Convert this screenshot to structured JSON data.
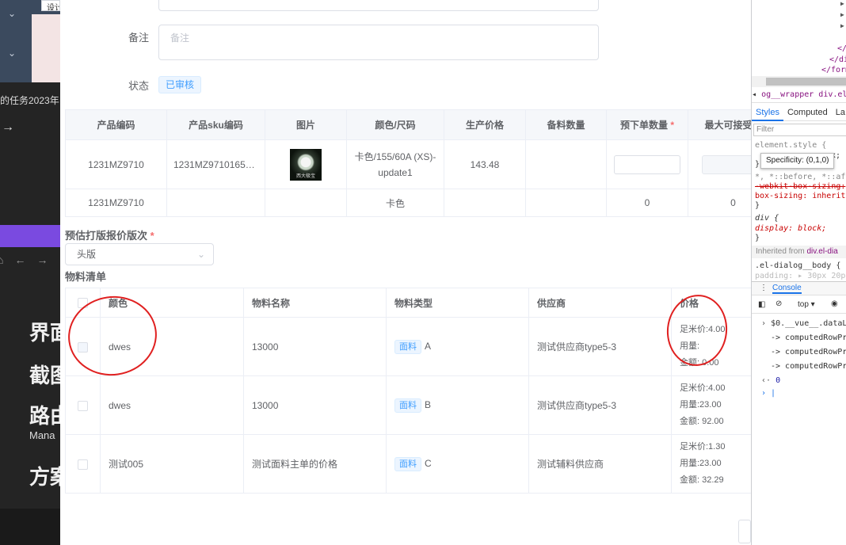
{
  "background_app": {
    "top_input_text": "设计",
    "task_text": "的任务2023年",
    "arrow": "→",
    "headings": [
      "界面",
      "截图",
      "路由",
      "方案"
    ],
    "subtext": "Mana"
  },
  "form": {
    "remark_label": "备注",
    "remark_placeholder": "备注",
    "status_label": "状态",
    "status_value": "已审核"
  },
  "product_table": {
    "headers": [
      "产品编码",
      "产品sku编码",
      "图片",
      "颜色/尺码",
      "生产价格",
      "备料数量",
      "预下单数量",
      "最大可接受数"
    ],
    "required_mark": "*",
    "rows": [
      {
        "code": "1231MZ9710",
        "sku": "1231MZ97101654…",
        "image_caption": "西大极宝",
        "color_size": "卡色/155/60A (XS)-update1",
        "price": "143.48",
        "prep_qty": "",
        "pre_order": "",
        "max_qty": ""
      },
      {
        "code": "1231MZ9710",
        "sku": "",
        "image_caption": "",
        "color_size": "卡色",
        "price": "",
        "prep_qty": "",
        "pre_order": "0",
        "max_qty": "0"
      }
    ]
  },
  "version": {
    "label": "预估打版报价版次",
    "required_mark": "*",
    "selected": "头版"
  },
  "materials": {
    "title": "物料清单",
    "headers": [
      "颜色",
      "物料名称",
      "物料类型",
      "供应商",
      "价格"
    ],
    "rows": [
      {
        "color": "dwes",
        "name": "13000",
        "type_tag": "面料",
        "type_code": "A",
        "supplier": "测试供应商type5-3",
        "price_lines": [
          "足米价:4.00",
          "用量:",
          "金额: 0.00"
        ]
      },
      {
        "color": "dwes",
        "name": "13000",
        "type_tag": "面料",
        "type_code": "B",
        "supplier": "测试供应商type5-3",
        "price_lines": [
          "足米价:4.00",
          "用量:23.00",
          "金额: 92.00"
        ]
      },
      {
        "color": "测试005",
        "name": "测试面料主单的价格",
        "type_tag": "面料",
        "type_code": "C",
        "supplier": "测试辅料供应商",
        "price_lines": [
          "足米价:1.30",
          "用量:23.00",
          "金额: 32.29"
        ]
      }
    ]
  },
  "devtools": {
    "tree_lines": [
      "</",
      "</di",
      "</form"
    ],
    "breadcrumbs": "og__wrapper  div.el-dia",
    "tabs": [
      "Styles",
      "Computed",
      "La"
    ],
    "filter_placeholder": "Filter",
    "css_lines": [
      "element.style {",
      "}",
      "*, *::before, *::after {",
      "  -webkit-box-sizing:",
      "  box-sizing: inherit",
      "}",
      "div {",
      "  display: block;",
      "}"
    ],
    "tooltip": "Specificity: (0,1,0)",
    "tooltip_tail": "px;",
    "inherited_label": "Inherited from",
    "inherited_target": "div.el-dia",
    "dialog_rule": ".el-dialog__body {",
    "padding_line": "  padding: ▸ 30px 20p",
    "console_tab": "Console",
    "context": "top",
    "log_lines": [
      "$0.__vue__.dataLis",
      "-> computedRowPric",
      "-> computedRowPric",
      "-> computedRowPric",
      "0"
    ]
  }
}
